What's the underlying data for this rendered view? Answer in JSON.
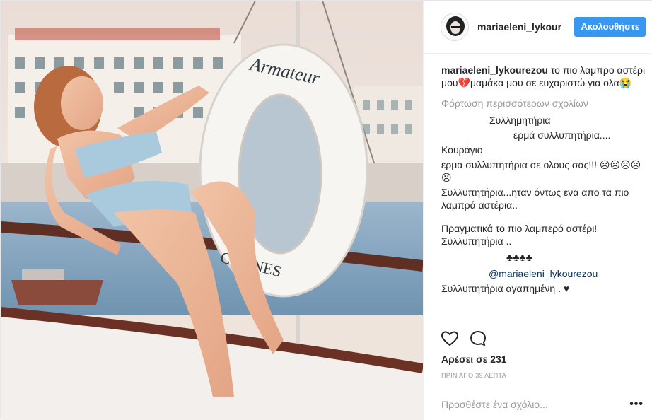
{
  "header": {
    "username": "mariaeleni_lykour",
    "follow_label": "Ακολουθήστε"
  },
  "photo": {
    "ring_top_text": "Armateur",
    "ring_bottom_text": "CANNES"
  },
  "caption": {
    "username": "mariaeleni_lykourezou",
    "text_1": " το πιο λαμπρο αστέρι μου",
    "heart": "💔",
    "text_2": "μαμάκα μου σε ευχαριστώ για ολα",
    "emoji": "😭"
  },
  "load_more": "Φόρτωση περισσότερων σχολίων",
  "comments": [
    {
      "text": "Συλλημητήρια"
    },
    {
      "text": "ερμά συλλυπητήρια...."
    },
    {
      "text": "Κουράγιο"
    },
    {
      "text": "ερμα συλλυπητήρια σε ολους σας!!! ☹☹☹☹☹"
    },
    {
      "text": "Συλλυπητήρια...ηταν όντως ενα απο τα πιο λαμπρά αστέρια.."
    },
    {
      "text": "Πραγματικά το πιο λαμπερό αστέρι! Συλλυπητήρια .."
    },
    {
      "text": "♣♣♣♣"
    },
    {
      "text": "@mariaeleni_lykourezou"
    },
    {
      "text": "Συλλυπητήρια αγαπημένη . ♥"
    }
  ],
  "likes": "Αρέσει σε 231",
  "time": "ΠΡΙΝ ΑΠΟ 39 ΛΕΠΤΑ",
  "add_comment_placeholder": "Προσθέστε ένα σχόλιο...",
  "more_label": "•••",
  "colors": {
    "accent": "#3897f0",
    "muted": "#999999",
    "text": "#262626",
    "mention": "#003569"
  }
}
